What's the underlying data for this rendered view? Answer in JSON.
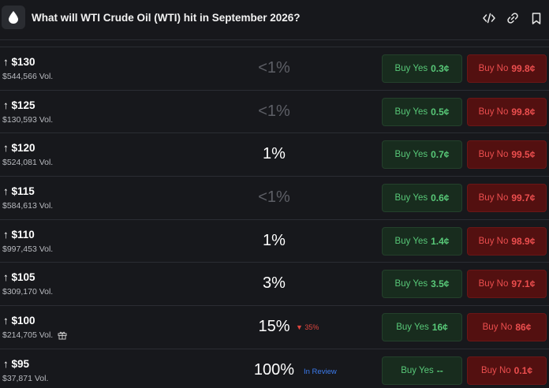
{
  "header": {
    "title": "What will WTI Crude Oil (WTI) hit in September 2026?",
    "icons": [
      "oil-drop-icon",
      "embed-code-icon",
      "link-icon",
      "bookmark-icon"
    ]
  },
  "colors": {
    "background": "#17181c",
    "yes_text": "#58c878",
    "yes_bg": "#182c1e",
    "no_text": "#ec4e4e",
    "no_bg": "#531010",
    "negative_delta": "#e0463f",
    "review_blue": "#3c7cf0"
  },
  "rows": [
    {
      "strike": "↑ $130",
      "volume": "$544,566 Vol.",
      "chance": "<1%",
      "dim": true,
      "yes_label": "Buy Yes",
      "yes_price": "0.3¢",
      "no_label": "Buy No",
      "no_price": "99.8¢"
    },
    {
      "strike": "↑ $125",
      "volume": "$130,593 Vol.",
      "chance": "<1%",
      "dim": true,
      "yes_label": "Buy Yes",
      "yes_price": "0.5¢",
      "no_label": "Buy No",
      "no_price": "99.8¢"
    },
    {
      "strike": "↑ $120",
      "volume": "$524,081 Vol.",
      "chance": "1%",
      "dim": false,
      "yes_label": "Buy Yes",
      "yes_price": "0.7¢",
      "no_label": "Buy No",
      "no_price": "99.5¢"
    },
    {
      "strike": "↑ $115",
      "volume": "$584,613 Vol.",
      "chance": "<1%",
      "dim": true,
      "yes_label": "Buy Yes",
      "yes_price": "0.6¢",
      "no_label": "Buy No",
      "no_price": "99.7¢"
    },
    {
      "strike": "↑ $110",
      "volume": "$997,453 Vol.",
      "chance": "1%",
      "dim": false,
      "yes_label": "Buy Yes",
      "yes_price": "1.4¢",
      "no_label": "Buy No",
      "no_price": "98.9¢"
    },
    {
      "strike": "↑ $105",
      "volume": "$309,170 Vol.",
      "chance": "3%",
      "dim": false,
      "yes_label": "Buy Yes",
      "yes_price": "3.5¢",
      "no_label": "Buy No",
      "no_price": "97.1¢"
    },
    {
      "strike": "↑ $100",
      "volume": "$214,705 Vol.",
      "chance": "15%",
      "dim": false,
      "delta": "▼ 35%",
      "gift": true,
      "yes_label": "Buy Yes",
      "yes_price": "16¢",
      "no_label": "Buy No",
      "no_price": "86¢"
    },
    {
      "strike": "↑ $95",
      "volume": "$37,871 Vol.",
      "chance": "100%",
      "dim": false,
      "status": "In Review",
      "yes_label": "Buy Yes",
      "yes_price": "--",
      "no_label": "Buy No",
      "no_price": "0.1¢"
    }
  ]
}
